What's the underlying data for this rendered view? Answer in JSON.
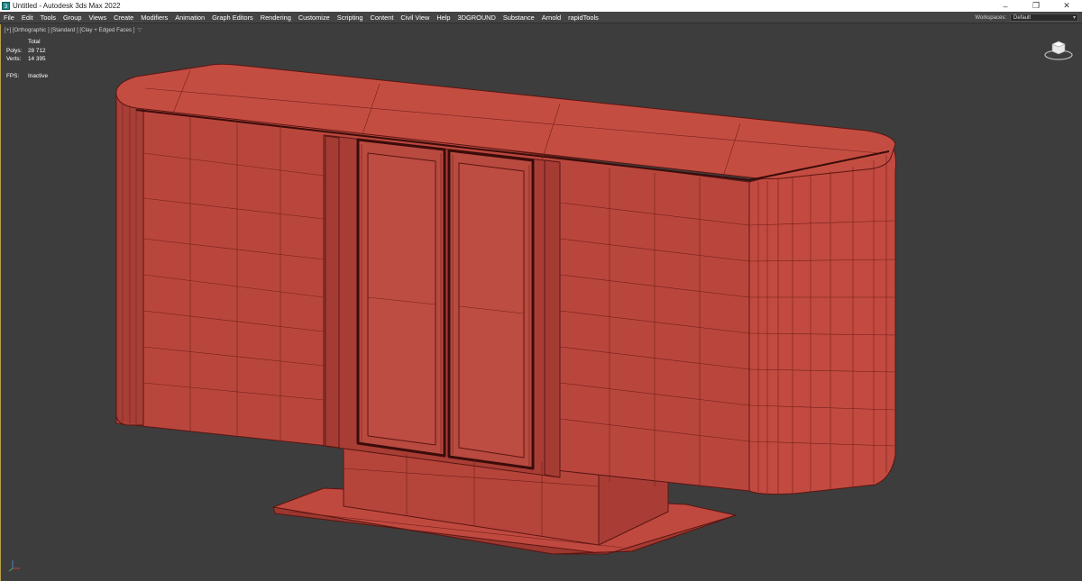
{
  "window": {
    "title": "Untitled - Autodesk 3ds Max 2022",
    "controls": [
      "minimize-icon",
      "restore-icon",
      "close-icon"
    ]
  },
  "menu": {
    "items": [
      "File",
      "Edit",
      "Tools",
      "Group",
      "Views",
      "Create",
      "Modifiers",
      "Animation",
      "Graph Editors",
      "Rendering",
      "Customize",
      "Scripting",
      "Content",
      "Civil View",
      "Help",
      "3DGROUND",
      "Substance",
      "Arnold",
      "rapidTools"
    ],
    "workspaces_label": "Workspaces:",
    "workspaces_value": "Default"
  },
  "viewport": {
    "label": "[+] [Orthographic ] [Standard ] [Clay + Edged Faces ]",
    "stats": {
      "header": "Total",
      "polys_label": "Polys:",
      "polys_value": "28 712",
      "verts_label": "Verts:",
      "verts_value": "14 395",
      "fps_label": "FPS:",
      "fps_value": "Inactive"
    }
  },
  "colors": {
    "viewport_bg": "#3d3d3d",
    "model_fill": "#b9463d",
    "wire": "#5a1612",
    "active_border": "#b8a24a"
  },
  "icons": [
    "app-icon",
    "viewcube-icon",
    "axis-tripod-icon",
    "filter-icon"
  ]
}
